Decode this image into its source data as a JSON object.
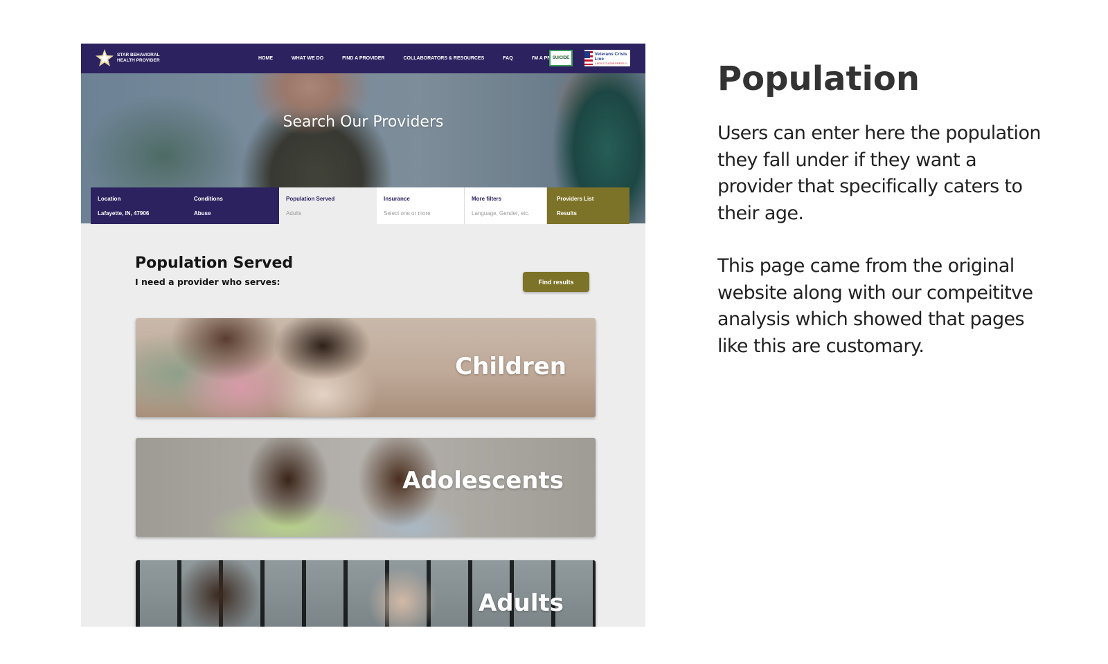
{
  "mockup": {
    "nav": {
      "logo_text": "STAR BEHAVIORAL HEALTH PROVIDER",
      "links": [
        "HOME",
        "WHAT WE DO",
        "FIND A PROVIDER",
        "COLLABORATORS & RESOURCES",
        "FAQ",
        "I'M A PROVIDER"
      ],
      "badge_suicide": "SUICIDE",
      "badge_veterans": "Veterans Crisis Line",
      "badge_veterans_phone": "1-800-273-8255 PRESS 1"
    },
    "hero": {
      "title": "Search Our Providers"
    },
    "filters": [
      {
        "label": "Location",
        "value": "Lafayette, IN, 47906"
      },
      {
        "label": "Conditions",
        "value": "Abuse"
      },
      {
        "label": "Population Served",
        "value": "Adults"
      },
      {
        "label": "Insurance",
        "value": "Select one or more"
      },
      {
        "label": "More filters",
        "value": "Language, Gender, etc."
      },
      {
        "label": "Providers List",
        "value": "Results"
      }
    ],
    "section": {
      "title": "Population Served",
      "subtitle": "I need a provider who serves:",
      "find_button": "Find results"
    },
    "cards": [
      "Children",
      "Adolescents",
      "Adults"
    ],
    "colors": {
      "nav": "#2d2260",
      "accent": "#7d7328"
    }
  },
  "annotation": {
    "title": "Population",
    "paragraph1": "Users can enter here the population they fall under if they want a provider that specifically caters to their age.",
    "paragraph2": "This page came from the original website along with our compeititve analysis which showed that pages like this are customary."
  }
}
